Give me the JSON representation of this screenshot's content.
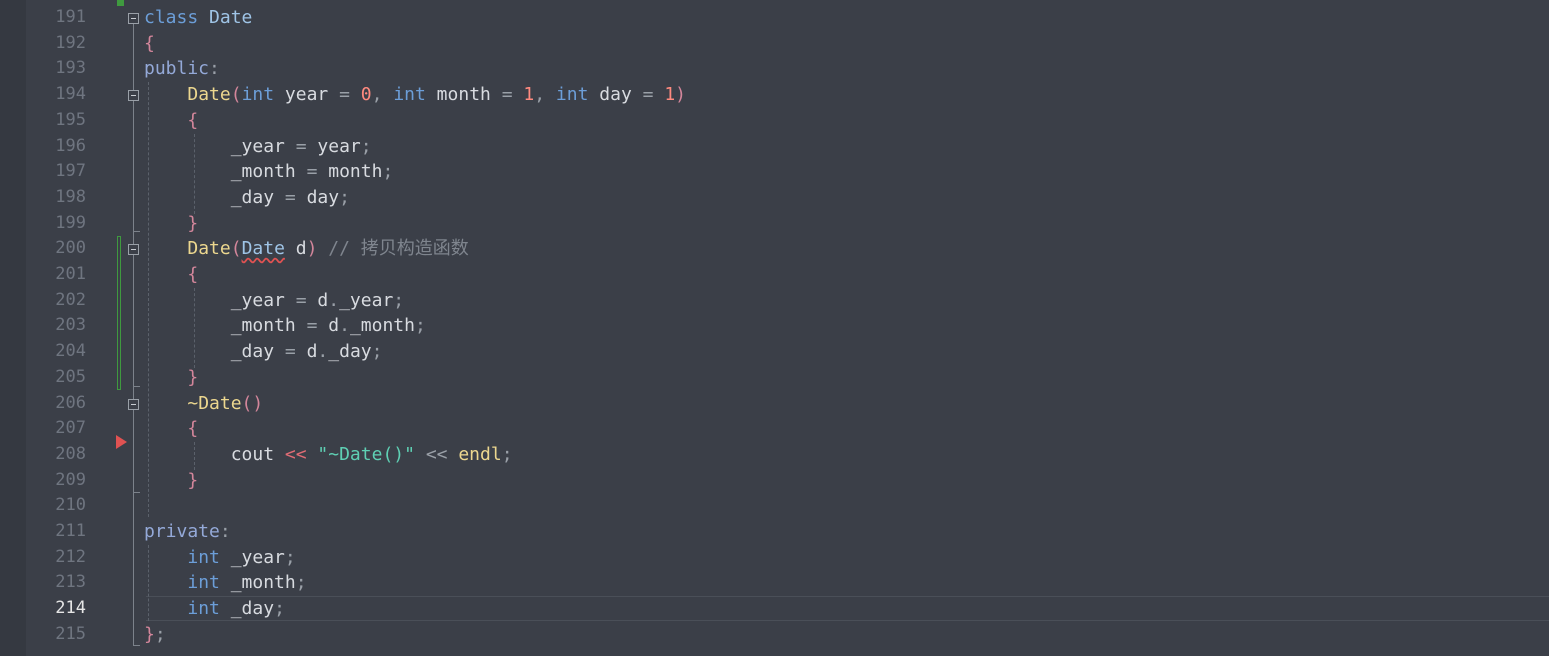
{
  "editor": {
    "current_line": "214",
    "lines": [
      {
        "num": "191",
        "tokens": [
          {
            "t": "class",
            "c": "kw"
          },
          {
            "t": " "
          },
          {
            "t": "Date",
            "c": "ty"
          }
        ]
      },
      {
        "num": "192",
        "tokens": [
          {
            "t": "{",
            "c": "br"
          }
        ]
      },
      {
        "num": "193",
        "tokens": [
          {
            "t": "public",
            "c": "kwp"
          },
          {
            "t": ":",
            "c": "pu"
          }
        ]
      },
      {
        "num": "194",
        "tokens": [
          {
            "t": "    "
          },
          {
            "t": "Date",
            "c": "fn"
          },
          {
            "t": "(",
            "c": "br"
          },
          {
            "t": "int",
            "c": "kw"
          },
          {
            "t": " year "
          },
          {
            "t": "=",
            "c": "pu"
          },
          {
            "t": " "
          },
          {
            "t": "0",
            "c": "num"
          },
          {
            "t": ",",
            "c": "pu"
          },
          {
            "t": " "
          },
          {
            "t": "int",
            "c": "kw"
          },
          {
            "t": " month "
          },
          {
            "t": "=",
            "c": "pu"
          },
          {
            "t": " "
          },
          {
            "t": "1",
            "c": "num"
          },
          {
            "t": ",",
            "c": "pu"
          },
          {
            "t": " "
          },
          {
            "t": "int",
            "c": "kw"
          },
          {
            "t": " day "
          },
          {
            "t": "=",
            "c": "pu"
          },
          {
            "t": " "
          },
          {
            "t": "1",
            "c": "num"
          },
          {
            "t": ")",
            "c": "br"
          }
        ]
      },
      {
        "num": "195",
        "tokens": [
          {
            "t": "    "
          },
          {
            "t": "{",
            "c": "br"
          }
        ]
      },
      {
        "num": "196",
        "tokens": [
          {
            "t": "        _year "
          },
          {
            "t": "=",
            "c": "pu"
          },
          {
            "t": " year"
          },
          {
            "t": ";",
            "c": "pu"
          }
        ]
      },
      {
        "num": "197",
        "tokens": [
          {
            "t": "        _month "
          },
          {
            "t": "=",
            "c": "pu"
          },
          {
            "t": " month"
          },
          {
            "t": ";",
            "c": "pu"
          }
        ]
      },
      {
        "num": "198",
        "tokens": [
          {
            "t": "        _day "
          },
          {
            "t": "=",
            "c": "pu"
          },
          {
            "t": " day"
          },
          {
            "t": ";",
            "c": "pu"
          }
        ]
      },
      {
        "num": "199",
        "tokens": [
          {
            "t": "    "
          },
          {
            "t": "}",
            "c": "br"
          }
        ]
      },
      {
        "num": "200",
        "tokens": [
          {
            "t": "    "
          },
          {
            "t": "Date",
            "c": "fn"
          },
          {
            "t": "(",
            "c": "br"
          },
          {
            "t": "Date",
            "c": "ty squig"
          },
          {
            "t": " d"
          },
          {
            "t": ")",
            "c": "br"
          },
          {
            "t": " "
          },
          {
            "t": "// 拷贝构造函数",
            "c": "cmt"
          }
        ]
      },
      {
        "num": "201",
        "tokens": [
          {
            "t": "    "
          },
          {
            "t": "{",
            "c": "br"
          }
        ]
      },
      {
        "num": "202",
        "tokens": [
          {
            "t": "        _year "
          },
          {
            "t": "=",
            "c": "pu"
          },
          {
            "t": " d"
          },
          {
            "t": ".",
            "c": "pu"
          },
          {
            "t": "_year"
          },
          {
            "t": ";",
            "c": "pu"
          }
        ]
      },
      {
        "num": "203",
        "tokens": [
          {
            "t": "        _month "
          },
          {
            "t": "=",
            "c": "pu"
          },
          {
            "t": " d"
          },
          {
            "t": ".",
            "c": "pu"
          },
          {
            "t": "_month"
          },
          {
            "t": ";",
            "c": "pu"
          }
        ]
      },
      {
        "num": "204",
        "tokens": [
          {
            "t": "        _day "
          },
          {
            "t": "=",
            "c": "pu"
          },
          {
            "t": " d"
          },
          {
            "t": ".",
            "c": "pu"
          },
          {
            "t": "_day"
          },
          {
            "t": ";",
            "c": "pu"
          }
        ]
      },
      {
        "num": "205",
        "tokens": [
          {
            "t": "    "
          },
          {
            "t": "}",
            "c": "br"
          }
        ]
      },
      {
        "num": "206",
        "tokens": [
          {
            "t": "    "
          },
          {
            "t": "~Date",
            "c": "fn"
          },
          {
            "t": "()",
            "c": "br"
          }
        ]
      },
      {
        "num": "207",
        "tokens": [
          {
            "t": "    "
          },
          {
            "t": "{",
            "c": "br"
          }
        ]
      },
      {
        "num": "208",
        "tokens": [
          {
            "t": "        cout "
          },
          {
            "t": "<<",
            "c": "op"
          },
          {
            "t": " "
          },
          {
            "t": "\"~Date()\"",
            "c": "str"
          },
          {
            "t": " "
          },
          {
            "t": "<<",
            "c": "pu"
          },
          {
            "t": " "
          },
          {
            "t": "endl",
            "c": "fn"
          },
          {
            "t": ";",
            "c": "pu"
          }
        ]
      },
      {
        "num": "209",
        "tokens": [
          {
            "t": "    "
          },
          {
            "t": "}",
            "c": "br"
          }
        ]
      },
      {
        "num": "210",
        "tokens": []
      },
      {
        "num": "211",
        "tokens": [
          {
            "t": "private",
            "c": "kwp"
          },
          {
            "t": ":",
            "c": "pu"
          }
        ]
      },
      {
        "num": "212",
        "tokens": [
          {
            "t": "    "
          },
          {
            "t": "int",
            "c": "kw"
          },
          {
            "t": " _year"
          },
          {
            "t": ";",
            "c": "pu"
          }
        ]
      },
      {
        "num": "213",
        "tokens": [
          {
            "t": "    "
          },
          {
            "t": "int",
            "c": "kw"
          },
          {
            "t": " _month"
          },
          {
            "t": ";",
            "c": "pu"
          }
        ]
      },
      {
        "num": "214",
        "tokens": [
          {
            "t": "    "
          },
          {
            "t": "int",
            "c": "kw"
          },
          {
            "t": " _day"
          },
          {
            "t": ";",
            "c": "pu"
          }
        ]
      },
      {
        "num": "215",
        "tokens": [
          {
            "t": "}",
            "c": "br"
          },
          {
            "t": ";",
            "c": "pu"
          }
        ]
      }
    ],
    "fold_lines": [
      "191",
      "194",
      "200",
      "206"
    ]
  }
}
